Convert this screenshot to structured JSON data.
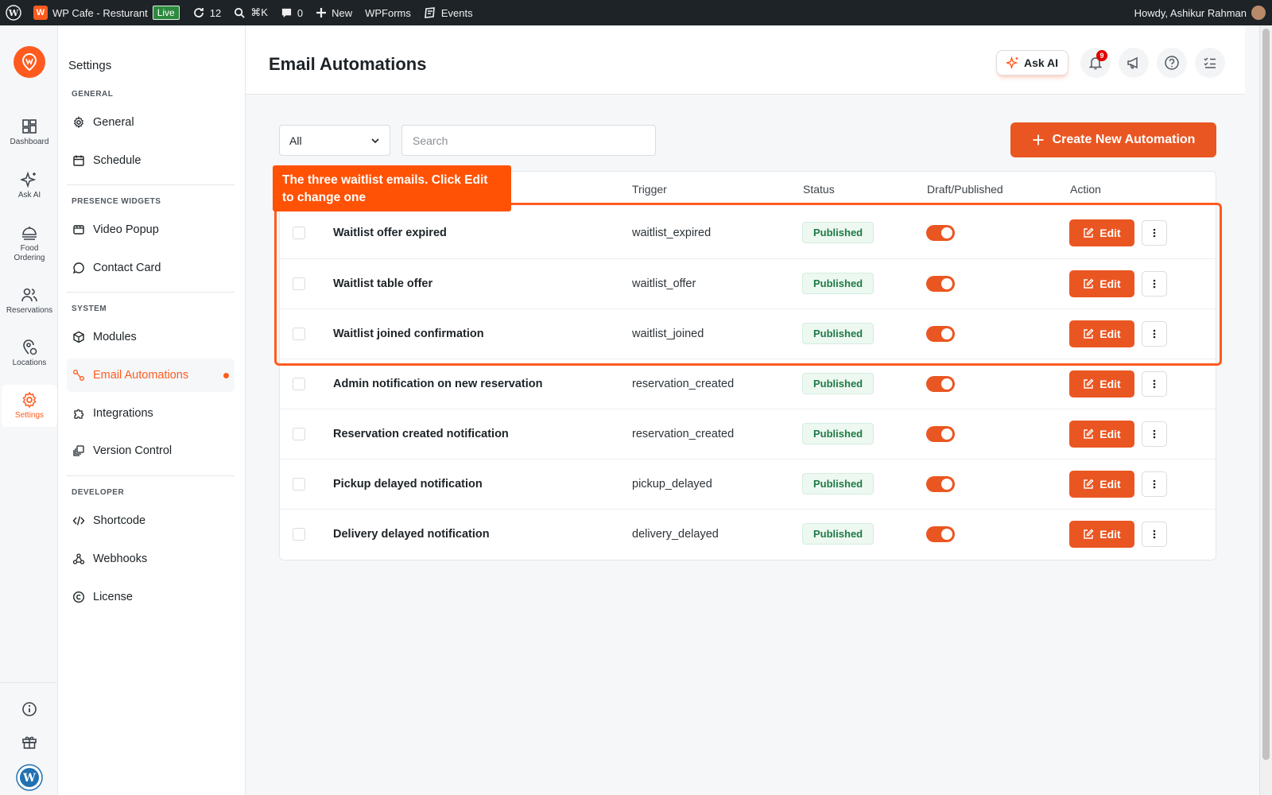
{
  "adminbar": {
    "site_name": "WP Cafe - Resturant",
    "live_label": "Live",
    "updates_count": "12",
    "search_shortcut": "⌘K",
    "comments_count": "0",
    "new_label": "New",
    "wpforms_label": "WPForms",
    "events_label": "Events",
    "greeting": "Howdy, Ashikur Rahman"
  },
  "rail": {
    "items": [
      {
        "label": "Dashboard",
        "icon": "dashboard-icon"
      },
      {
        "label": "Ask AI",
        "icon": "sparkle-icon"
      },
      {
        "label": "Food Ordering",
        "icon": "food-icon"
      },
      {
        "label": "Reservations",
        "icon": "users-icon"
      },
      {
        "label": "Locations",
        "icon": "location-icon"
      },
      {
        "label": "Settings",
        "icon": "gear-icon"
      }
    ]
  },
  "sidebar": {
    "title": "Settings",
    "sections": {
      "general": "GENERAL",
      "presence": "PRESENCE WIDGETS",
      "system": "SYSTEM",
      "developer": "DEVELOPER"
    },
    "items": [
      {
        "label": "General"
      },
      {
        "label": "Schedule"
      },
      {
        "label": "Video Popup"
      },
      {
        "label": "Contact Card"
      },
      {
        "label": "Modules"
      },
      {
        "label": "Email Automations"
      },
      {
        "label": "Integrations"
      },
      {
        "label": "Version Control"
      },
      {
        "label": "Shortcode"
      },
      {
        "label": "Webhooks"
      },
      {
        "label": "License"
      }
    ]
  },
  "header": {
    "title": "Email Automations",
    "ask_ai": "Ask AI",
    "notification_count": "9"
  },
  "toolbar": {
    "filter_value": "All",
    "search_placeholder": "Search",
    "create_label": "Create New Automation"
  },
  "table": {
    "columns": [
      "Trigger",
      "Status",
      "Draft/Published",
      "Action"
    ],
    "edit_label": "Edit",
    "rows": [
      {
        "name": "Waitlist offer expired",
        "trigger": "waitlist_expired",
        "status": "Published",
        "published": true
      },
      {
        "name": "Waitlist table offer",
        "trigger": "waitlist_offer",
        "status": "Published",
        "published": true
      },
      {
        "name": "Waitlist joined confirmation",
        "trigger": "waitlist_joined",
        "status": "Published",
        "published": true
      },
      {
        "name": "Admin notification on new reservation",
        "trigger": "reservation_created",
        "status": "Published",
        "published": true
      },
      {
        "name": "Reservation created notification",
        "trigger": "reservation_created",
        "status": "Published",
        "published": true
      },
      {
        "name": "Pickup delayed notification",
        "trigger": "pickup_delayed",
        "status": "Published",
        "published": true
      },
      {
        "name": "Delivery delayed notification",
        "trigger": "delivery_delayed",
        "status": "Published",
        "published": true
      }
    ]
  },
  "annotation": {
    "callout": "The three waitlist emails. Click Edit to change one"
  },
  "colors": {
    "accent": "#ea5622",
    "admin_bar": "#1d2327",
    "published_badge": "#1e7a45"
  }
}
